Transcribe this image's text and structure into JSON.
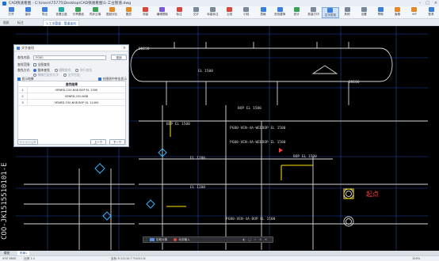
{
  "window": {
    "title": "CAD快速看图 - C:\\Users\\75775\\Desktop\\CAD快速看图\\1-工业管道.dwg"
  },
  "ribbon": [
    {
      "label": "打开",
      "icon": "folder-open-icon",
      "color": "blue"
    },
    {
      "label": "保存",
      "icon": "save-icon",
      "color": "blue"
    },
    {
      "label": "导出",
      "icon": "export-icon",
      "color": "blue"
    },
    {
      "label": "查看云盘",
      "icon": "cloud-icon",
      "color": "teal"
    },
    {
      "label": "分享图纸",
      "icon": "share-icon",
      "color": "green"
    },
    {
      "label": "同步云端",
      "icon": "sync-icon",
      "color": "green"
    },
    {
      "label": "图纸对比",
      "icon": "compare-icon",
      "color": "orange"
    },
    {
      "label": "图层",
      "icon": "layers-icon",
      "color": "orange"
    },
    {
      "label": "测量",
      "icon": "measure-icon",
      "color": "red"
    },
    {
      "label": "编辑提取",
      "icon": "edit-icon",
      "color": "purple"
    },
    {
      "label": "标注",
      "icon": "annotation-icon",
      "color": "red"
    },
    {
      "label": "文字",
      "icon": "text-icon",
      "color": "gray"
    },
    {
      "label": "标高标注",
      "icon": "elevation-icon",
      "color": "gray"
    },
    {
      "label": "云线",
      "icon": "cloud-line-icon",
      "color": "red"
    },
    {
      "label": "引线",
      "icon": "leader-icon",
      "color": "gray"
    },
    {
      "label": "表格",
      "icon": "table-icon",
      "color": "blue"
    },
    {
      "label": "查找替换",
      "icon": "find-icon",
      "color": "blue"
    },
    {
      "label": "统计",
      "icon": "count-icon",
      "color": "green"
    },
    {
      "label": "批量打印",
      "icon": "print-icon",
      "color": "gray"
    },
    {
      "label": "文字查找",
      "icon": "text-search-icon",
      "color": "blue"
    },
    {
      "label": "其他",
      "icon": "more-icon",
      "color": "gray"
    },
    {
      "label": "设置",
      "icon": "settings-icon",
      "color": "gray"
    },
    {
      "label": "帮助",
      "icon": "help-icon",
      "color": "blue"
    },
    {
      "label": "客服",
      "icon": "service-icon",
      "color": "orange"
    },
    {
      "label": "VIP",
      "icon": "vip-icon",
      "color": "orange"
    },
    {
      "label": "登录",
      "icon": "user-icon",
      "color": "blue"
    }
  ],
  "ribbon_active_index": 19,
  "tabs": [
    {
      "label": "图纸",
      "active": false
    },
    {
      "label": "标注",
      "active": false
    },
    {
      "label": "1-工业管道 - 管道走向",
      "active": true
    }
  ],
  "dialog": {
    "title": "文字查找",
    "search_label": "查找内容:",
    "search_value": "PG80",
    "search_button": "查找",
    "scope_label": "查找范围:",
    "scope_opt": "全图查找",
    "mode_label": "查找方式:",
    "mode_options": [
      "整体查找",
      "模糊查找",
      "按行查找",
      "区分大小写"
    ],
    "mode2_options": [
      "模糊匹配到文字",
      "全字匹配"
    ],
    "check1": "显示结果",
    "check2": "在图纸中突出显示",
    "table_header": "查找结果",
    "results": [
      {
        "n": "1",
        "v": "VENRD-150-N08 BOP EL 1500"
      },
      {
        "n": "2",
        "v": "VENRD-150-N08"
      },
      {
        "n": "3",
        "v": "VENRD-150-N08 BOP EL 11400"
      }
    ],
    "footer_left": "导出查找结果",
    "btn_prev": "上一个",
    "btn_next": "下一个"
  },
  "drawing_labels": [
    "EL 1500",
    "BOP EL 1500",
    "DN150",
    "DN100",
    "EL 1200",
    "BOP EL 1500",
    "BOP EL 1500",
    "PG80-VEN-4A-WEEDOP EL 1500",
    "PG80-VEN-4A-WEEDOP EL 1500",
    "起点",
    "EL 1200",
    "PG80-VEN-4A-BOP EL 1500",
    "COO-JK1515510101-E"
  ],
  "highlight_label": "起点",
  "command_bar": {
    "items": [
      "拾取对象",
      "动态输入"
    ]
  },
  "sheets": [
    "模型",
    "布局1"
  ],
  "status": {
    "coords": "XYZ 9800",
    "ratio": "比例 1:1",
    "coords2": "坐标 X:12110.7 Y:1011.8",
    "zoom": "100%"
  }
}
